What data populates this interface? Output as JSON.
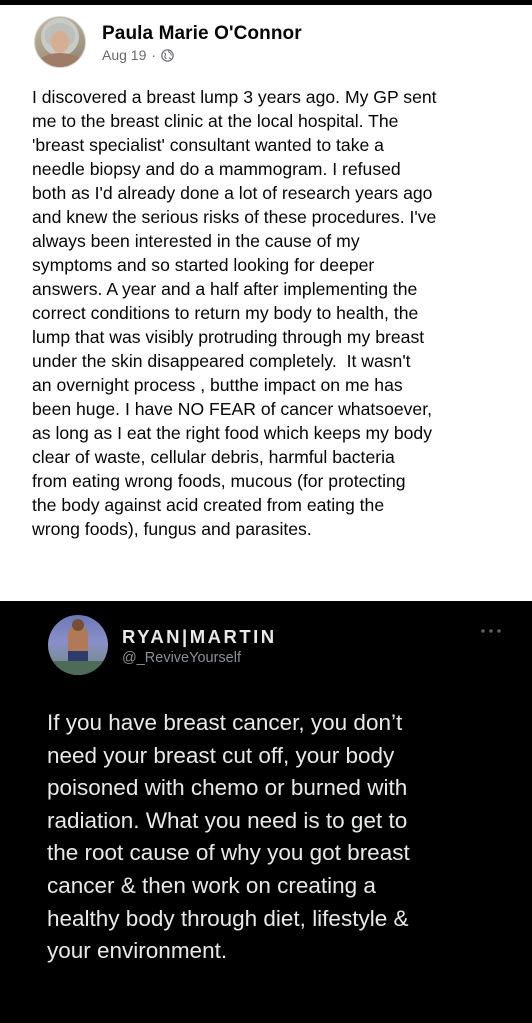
{
  "facebook_post": {
    "author": "Paula Marie O'Connor",
    "date": "Aug 19",
    "separator": "·",
    "audience_icon": "globe-icon",
    "body_lines": [
      "I discovered a breast lump 3 years ago. My GP sent",
      "me to the breast clinic at the local hospital. The",
      "'breast specialist' consultant wanted to take a",
      "needle biopsy and do a mammogram. I refused",
      "both as I'd already done a lot of research years ago",
      "and knew the serious risks of these procedures. I've",
      "always been interested in the cause of my",
      "symptoms and so started looking for deeper",
      "answers. A year and a half after implementing the",
      "correct conditions to return my body to health, the",
      "lump that was visibly protruding through my breast",
      "under the skin disappeared completely.  It wasn't",
      "an overnight process , butthe impact on me has",
      "been huge. I have NO FEAR of cancer whatsoever,",
      "as long as I eat the right food which keeps my body",
      "clear of waste, cellular debris, harmful bacteria",
      "from eating wrong foods, mucous (for protecting",
      "the body against acid created from eating the",
      "wrong foods), fungus and parasites."
    ]
  },
  "tweet": {
    "display_name": "RYAN|MARTIN",
    "handle": "@_ReviveYourself",
    "more_icon": "more-horizontal-icon",
    "body_lines": [
      "If you have breast cancer, you don’t",
      "need your breast cut off, your body",
      "poisoned with chemo or burned with",
      "radiation. What you need is to get to",
      "the root cause of why you got breast",
      "cancer & then work on creating a",
      "healthy body through diet, lifestyle &",
      "your environment."
    ]
  },
  "colors": {
    "facebook_background": "#ffffff",
    "facebook_text": "#050505",
    "facebook_meta": "#65676b",
    "tweet_background": "#000000",
    "tweet_text": "#e7e9ea",
    "tweet_handle": "#8b9198"
  }
}
